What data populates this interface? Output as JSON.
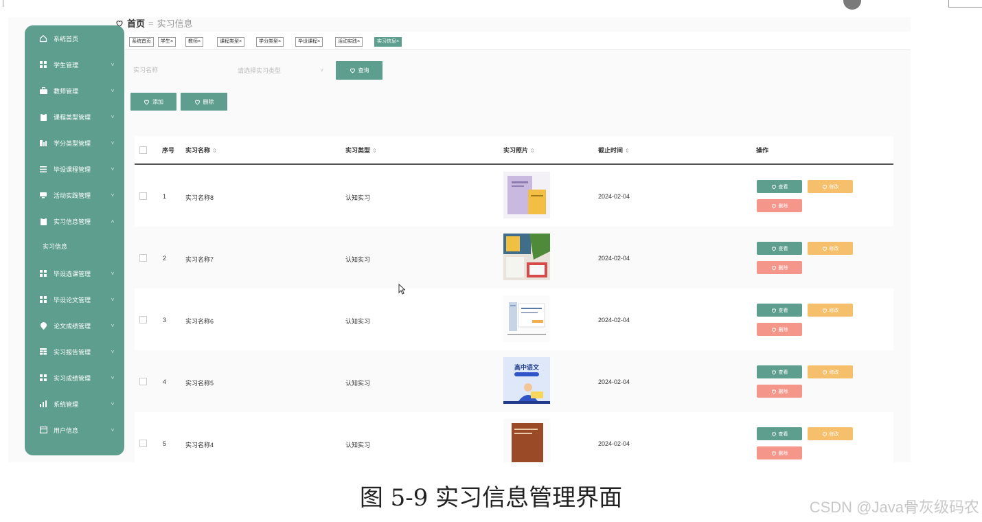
{
  "breadcrumb": {
    "home": "首页",
    "sep": "=",
    "current": "实习信息"
  },
  "sidebar": {
    "items": [
      {
        "label": "系统首页",
        "icon": "home-icon",
        "chevron": ""
      },
      {
        "label": "学生管理",
        "icon": "grid-icon",
        "chevron": "˅"
      },
      {
        "label": "教师管理",
        "icon": "briefcase-icon",
        "chevron": "˅"
      },
      {
        "label": "课程类型管理",
        "icon": "clipboard-icon",
        "chevron": "˅"
      },
      {
        "label": "学分类型管理",
        "icon": "bar-chart-icon",
        "chevron": "˅"
      },
      {
        "label": "毕设课程管理",
        "icon": "list-icon",
        "chevron": "˅"
      },
      {
        "label": "活动实践管理",
        "icon": "monitor-icon",
        "chevron": "˅"
      },
      {
        "label": "实习信息管理",
        "icon": "clipboard-icon",
        "chevron": "˄"
      },
      {
        "label": "毕设选课管理",
        "icon": "grid-icon",
        "chevron": "˅"
      },
      {
        "label": "毕设论文管理",
        "icon": "grid-icon",
        "chevron": "˅"
      },
      {
        "label": "论文成绩管理",
        "icon": "location-icon",
        "chevron": "˅"
      },
      {
        "label": "实习报告管理",
        "icon": "table-icon",
        "chevron": "˅"
      },
      {
        "label": "实习成绩管理",
        "icon": "grid-icon",
        "chevron": "˅"
      },
      {
        "label": "系统管理",
        "icon": "bar-chart-icon",
        "chevron": "˅"
      },
      {
        "label": "用户信息",
        "icon": "window-icon",
        "chevron": "˅"
      }
    ],
    "submenu": {
      "label": "实习信息"
    }
  },
  "tags": [
    {
      "label": "系统首页"
    },
    {
      "label": "学生×"
    },
    {
      "label": "教师×"
    },
    {
      "label": "课程类型×"
    },
    {
      "label": "学分类型×"
    },
    {
      "label": "毕设课程×"
    },
    {
      "label": "活动实践×"
    },
    {
      "label": "实习信息×",
      "active": true
    }
  ],
  "search": {
    "name_placeholder": "实习名称",
    "type_placeholder": "请选择实习类型",
    "query_label": "查询"
  },
  "actions": {
    "add_label": "添加",
    "delete_label": "删除"
  },
  "table": {
    "headers": {
      "index": "序号",
      "name": "实习名称",
      "type": "实习类型",
      "photo": "实习照片",
      "deadline": "截止时间",
      "ops": "操作"
    },
    "sort_glyph": "⇕",
    "rows": [
      {
        "index": "1",
        "name": "实习名称8",
        "type": "认知实习",
        "deadline": "2024-02-04",
        "view": "查看",
        "edit": "修改",
        "del": "删除"
      },
      {
        "index": "2",
        "name": "实习名称7",
        "type": "认知实习",
        "deadline": "2024-02-04",
        "view": "查看",
        "edit": "修改",
        "del": "删除"
      },
      {
        "index": "3",
        "name": "实习名称6",
        "type": "认知实习",
        "deadline": "2024-02-04",
        "view": "查看",
        "edit": "修改",
        "del": "删除"
      },
      {
        "index": "4",
        "name": "实习名称5",
        "type": "认知实习",
        "deadline": "2024-02-04",
        "view": "查看",
        "edit": "修改",
        "del": "删除"
      },
      {
        "index": "5",
        "name": "实习名称4",
        "type": "认知实习",
        "deadline": "2024-02-04",
        "view": "查看",
        "edit": "修改",
        "del": "删除"
      }
    ]
  },
  "thumb_text": {
    "book_title": "高中语文"
  },
  "caption": "图 5-9 实习信息管理界面",
  "watermark": "CSDN @Java骨灰级码农",
  "colors": {
    "primary": "#5d9e8e",
    "edit": "#f6bf6b",
    "delete": "#f5968a"
  }
}
